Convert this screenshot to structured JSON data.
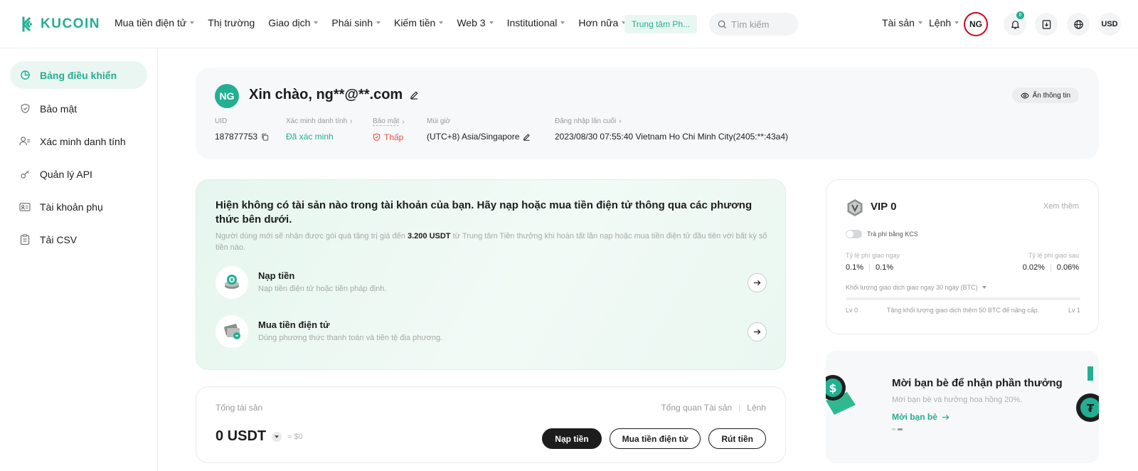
{
  "brand": {
    "name": "KUCOIN",
    "accent": "#23af91"
  },
  "nav": {
    "items": [
      {
        "label": "Mua tiền điện tử",
        "dropdown": true
      },
      {
        "label": "Thị trường",
        "dropdown": false
      },
      {
        "label": "Giao dịch",
        "dropdown": true
      },
      {
        "label": "Phái sinh",
        "dropdown": true
      },
      {
        "label": "Kiếm tiền",
        "dropdown": true
      },
      {
        "label": "Web 3",
        "dropdown": true
      },
      {
        "label": "Institutional",
        "dropdown": true
      },
      {
        "label": "Hơn nữa",
        "dropdown": true
      }
    ],
    "promo": "Trung tâm Ph...",
    "search_placeholder": "Tìm kiếm",
    "assets": "Tài sản",
    "orders": "Lệnh",
    "avatar": "NG",
    "notifications": "6",
    "currency": "USD"
  },
  "sidebar": {
    "items": [
      {
        "label": "Bảng điều khiển",
        "icon": "dashboard-icon",
        "active": true
      },
      {
        "label": "Bảo mật",
        "icon": "shield-icon",
        "active": false
      },
      {
        "label": "Xác minh danh tính",
        "icon": "user-verify-icon",
        "active": false
      },
      {
        "label": "Quản lý API",
        "icon": "api-icon",
        "active": false
      },
      {
        "label": "Tài khoản phụ",
        "icon": "sub-account-icon",
        "active": false
      },
      {
        "label": "Tải CSV",
        "icon": "csv-file-icon",
        "active": false
      }
    ]
  },
  "profile": {
    "avatar": "NG",
    "greeting": "Xin chào, ng**@**.com",
    "hide_info": "Ẩn thông tin",
    "uid_label": "UID",
    "uid": "187877753",
    "kyc_label": "Xác minh danh tính",
    "kyc_value": "Đã xác minh",
    "security_label": "Bảo mật",
    "security_value": "Thấp",
    "timezone_label": "Múi giờ",
    "timezone_value": "(UTC+8) Asia/Singapore",
    "last_login_label": "Đăng nhập lần cuối",
    "last_login_value": "2023/08/30 07:55:40 Vietnam Ho Chi Minh City(2405:**:43a4)"
  },
  "empty": {
    "title": "Hiện không có tài sản nào trong tài khoản của bạn. Hãy nạp hoặc mua tiền điện tử thông qua các phương thức bên dưới.",
    "desc_before": "Người dùng mới sẽ nhận được gói quà tặng trị giá đến",
    "desc_amount": "3.200 USDT",
    "desc_after": "từ Trung tâm Tiền thưởng khi hoàn tất lần nạp hoặc mua tiền điện tử đầu tiên với bất kỳ số tiền nào.",
    "deposit_title": "Nạp tiền",
    "deposit_sub": "Nạp tiền điện tử hoặc tiền pháp định.",
    "buy_title": "Mua tiền điện tử",
    "buy_sub": "Dùng phương thức thanh toán và tiền tệ địa phương."
  },
  "assets": {
    "label": "Tổng tài sản",
    "overview_link": "Tổng quan Tài sản",
    "orders_link": "Lệnh",
    "balance": "0 USDT",
    "balance_fiat": "≈ $0",
    "deposit_btn": "Nạp tiền",
    "buy_btn": "Mua tiền điện tử",
    "withdraw_btn": "Rút tiền"
  },
  "vip": {
    "title": "VIP 0",
    "more": "Xem thêm",
    "kcs_toggle": "Trả phí bằng KCS",
    "spot_fee_label": "Tỷ lệ phí giao ngay",
    "spot_maker": "0.1%",
    "spot_taker": "0.1%",
    "futures_fee_label": "Tỷ lệ phí giao sau",
    "futures_maker": "0.02%",
    "futures_taker": "0.06%",
    "volume_label": "Khối lượng giao dịch giao ngay 30 ngày (BTC)",
    "progress": 0,
    "lv_start": "Lv 0",
    "lv_note": "Tăng khối lượng giao dịch thêm 50 BTC để nâng cấp.",
    "lv_end": "Lv 1"
  },
  "invite": {
    "title": "Mời bạn bè để nhận phần thưởng",
    "sub": "Mời bạn bè và hưởng hoa hồng 20%.",
    "link": "Mời bạn bè"
  }
}
